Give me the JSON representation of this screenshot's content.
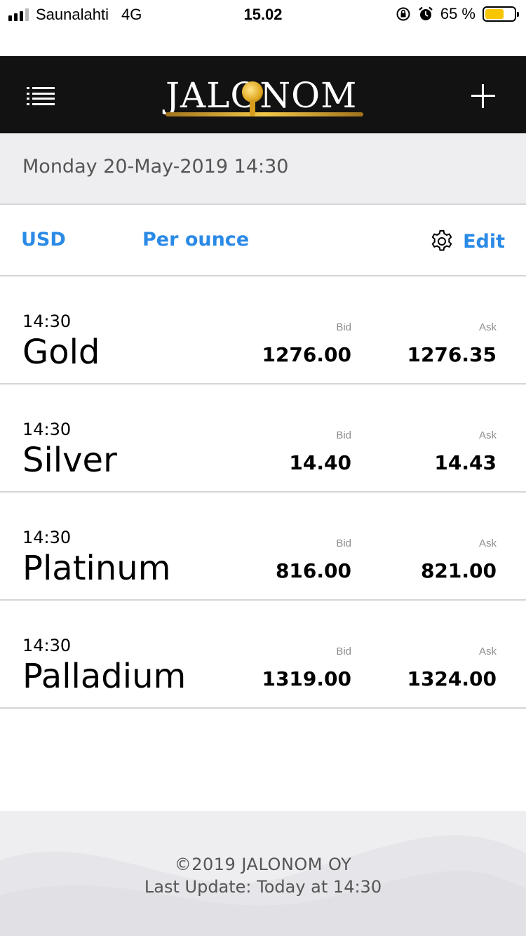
{
  "status_bar": {
    "carrier": "Saunalahti",
    "network": "4G",
    "time": "15.02",
    "battery_percent": "65 %",
    "battery_level": 0.65,
    "icons": [
      "signal-icon",
      "rotation-lock-icon",
      "alarm-icon",
      "battery-icon"
    ]
  },
  "header": {
    "logo_text": "JALONOM",
    "menu_icon": "menu-icon",
    "add_icon": "plus-icon"
  },
  "date": "Monday 20-May-2019 14:30",
  "toolbar": {
    "currency": "USD",
    "unit": "Per ounce",
    "edit_label": "Edit",
    "edit_icon": "gear-icon",
    "accent_color": "#2b8ae6"
  },
  "columns": {
    "bid": "Bid",
    "ask": "Ask"
  },
  "metals": [
    {
      "time": "14:30",
      "name": "Gold",
      "bid": "1276.00",
      "ask": "1276.35"
    },
    {
      "time": "14:30",
      "name": "Silver",
      "bid": "14.40",
      "ask": "14.43"
    },
    {
      "time": "14:30",
      "name": "Platinum",
      "bid": "816.00",
      "ask": "821.00"
    },
    {
      "time": "14:30",
      "name": "Palladium",
      "bid": "1319.00",
      "ask": "1324.00"
    }
  ],
  "footer": {
    "copyright": "©2019 JALONOM OY",
    "last_update": "Last Update: Today at 14:30"
  }
}
